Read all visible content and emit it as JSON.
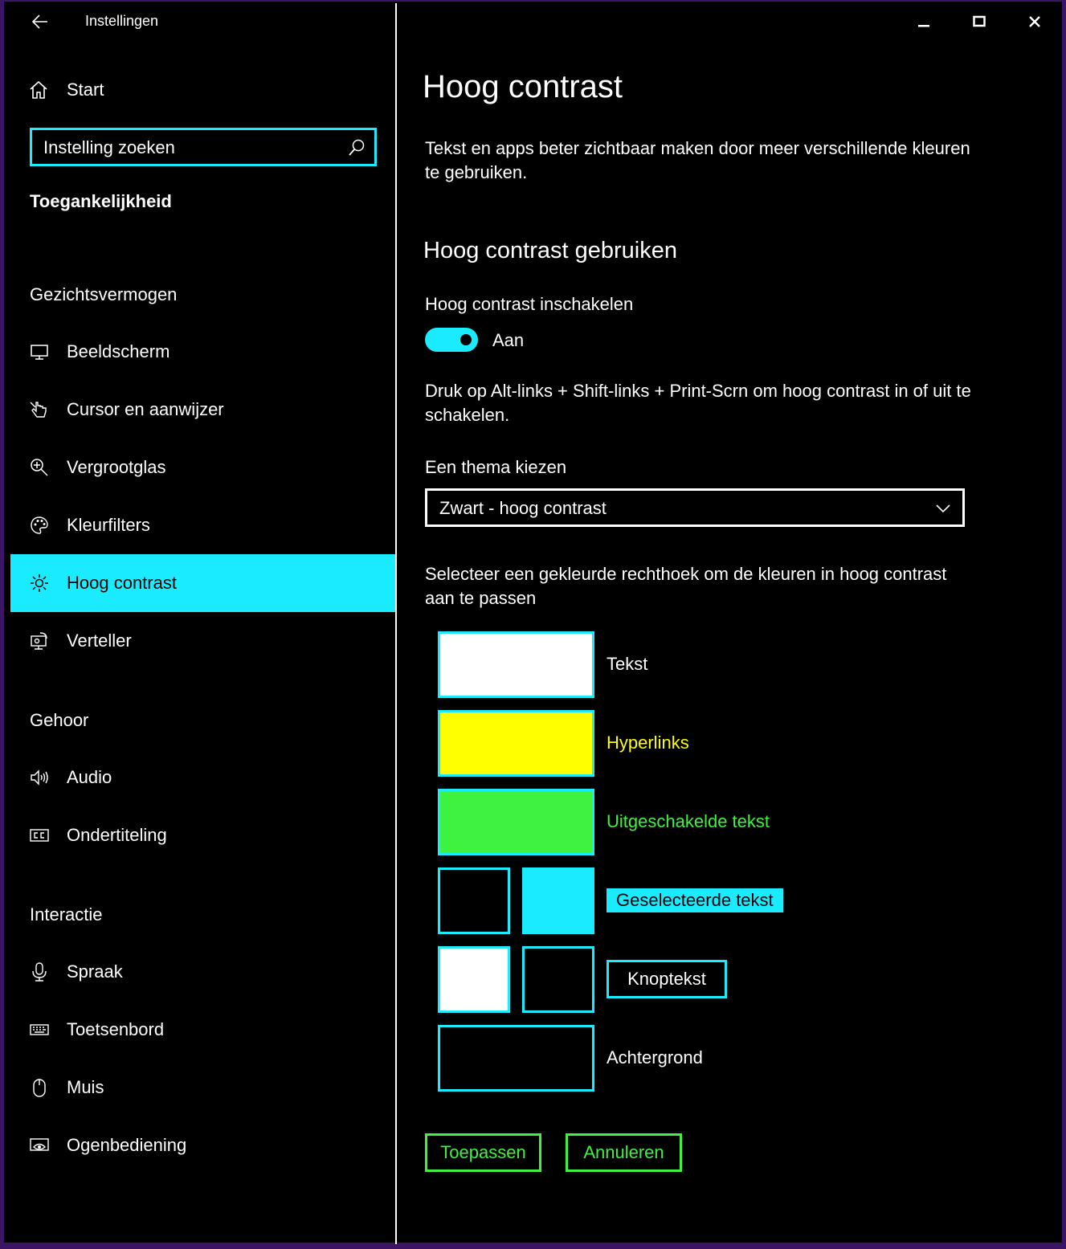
{
  "window": {
    "title": "Instellingen",
    "controls": [
      "minimize",
      "maximize",
      "close"
    ]
  },
  "sidebar": {
    "start_label": "Start",
    "search": {
      "placeholder": "Instelling zoeken",
      "icon": "search-icon"
    },
    "category": "Toegankelijkheid",
    "groups": [
      {
        "heading": "Gezichtsvermogen",
        "items": [
          {
            "label": "Beeldscherm",
            "icon": "monitor-icon"
          },
          {
            "label": "Cursor en aanwijzer",
            "icon": "cursor-hand-icon"
          },
          {
            "label": "Vergrootglas",
            "icon": "magnifier-icon"
          },
          {
            "label": "Kleurfilters",
            "icon": "palette-icon"
          },
          {
            "label": "Hoog contrast",
            "icon": "brightness-icon",
            "active": true
          },
          {
            "label": "Verteller",
            "icon": "narrator-icon"
          }
        ]
      },
      {
        "heading": "Gehoor",
        "items": [
          {
            "label": "Audio",
            "icon": "speaker-icon"
          },
          {
            "label": "Ondertiteling",
            "icon": "closed-caption-icon"
          }
        ]
      },
      {
        "heading": "Interactie",
        "items": [
          {
            "label": "Spraak",
            "icon": "microphone-icon"
          },
          {
            "label": "Toetsenbord",
            "icon": "keyboard-icon"
          },
          {
            "label": "Muis",
            "icon": "mouse-icon"
          },
          {
            "label": "Ogenbediening",
            "icon": "eye-control-icon"
          }
        ]
      }
    ]
  },
  "main": {
    "title": "Hoog contrast",
    "description": "Tekst en apps beter zichtbaar maken door meer verschillende kleuren te gebruiken.",
    "section_heading": "Hoog contrast gebruiken",
    "toggle": {
      "label": "Hoog contrast inschakelen",
      "state": "Aan",
      "on": true
    },
    "shortcut_hint": "Druk op Alt-links + Shift-links + Print-Scrn om hoog contrast in of uit te schakelen.",
    "theme": {
      "label": "Een thema kiezen",
      "selected": "Zwart - hoog contrast"
    },
    "swatch_hint": "Selecteer een gekleurde rechthoek om de kleuren in hoog contrast aan te passen",
    "swatches": {
      "text": {
        "label": "Tekst",
        "color": "#ffffff"
      },
      "hyperlinks": {
        "label": "Hyperlinks",
        "color": "#ffff00"
      },
      "disabled": {
        "label": "Uitgeschakelde tekst",
        "color": "#3ff23f"
      },
      "selected": {
        "label": "Geselecteerde tekst",
        "text_color": "#000000",
        "background": "#1aebff"
      },
      "button": {
        "label": "Knoptekst",
        "text_color": "#ffffff",
        "background": "#000000"
      },
      "background": {
        "label": "Achtergrond",
        "color": "#000000"
      }
    },
    "buttons": {
      "apply": "Toepassen",
      "cancel": "Annuleren"
    }
  },
  "colors": {
    "accent": "#1aebff",
    "action": "#3ff23f",
    "frame": "#3b1466"
  }
}
